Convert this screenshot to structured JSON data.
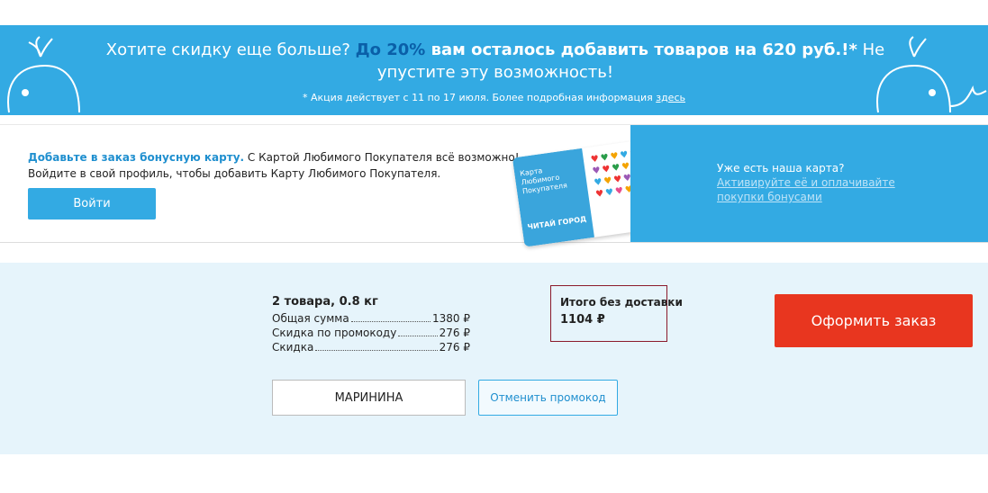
{
  "promo": {
    "text_pre": "Хотите скидку еще больше? ",
    "text_highlight": "До 20%",
    "text_bold": " вам осталось добавить товаров на 620 руб.!*",
    "text_post": " Не упустите эту возможность!",
    "note_text": "* Акция действует с 11 по 17 июля. Более подробная информация ",
    "note_link": "здесь"
  },
  "loyalty": {
    "title_bold": "Добавьте в заказ бонусную карту.",
    "title_rest": " С Картой Любимого Покупателя всё возможно!",
    "subtitle": "Войдите в свой профиль, чтобы добавить Карту Любимого Покупателя.",
    "login_button": "Войти",
    "card_text": "Карта Любимого Покупателя",
    "card_brand": "ЧИТАЙ ГОРОД",
    "has_card_label": "Уже есть наша карта?",
    "activate_link": "Активируйте её и оплачивайте покупки бонусами"
  },
  "summary": {
    "items_head": "2 товара, 0.8 кг",
    "rows": [
      {
        "label": "Общая сумма",
        "value": "1380 ₽"
      },
      {
        "label": "Скидка по промокоду",
        "value": "276 ₽"
      },
      {
        "label": "Скидка",
        "value": "276 ₽"
      }
    ],
    "total_label": "Итого без доставки",
    "total_value": "1104 ₽",
    "order_button": "Оформить заказ",
    "promo_code_value": "МАРИНИНА",
    "cancel_promo_button": "Отменить промокод"
  },
  "colors": {
    "accent_blue": "#33aae3",
    "order_red": "#e8361f",
    "summary_bg": "#e6f4fb"
  }
}
